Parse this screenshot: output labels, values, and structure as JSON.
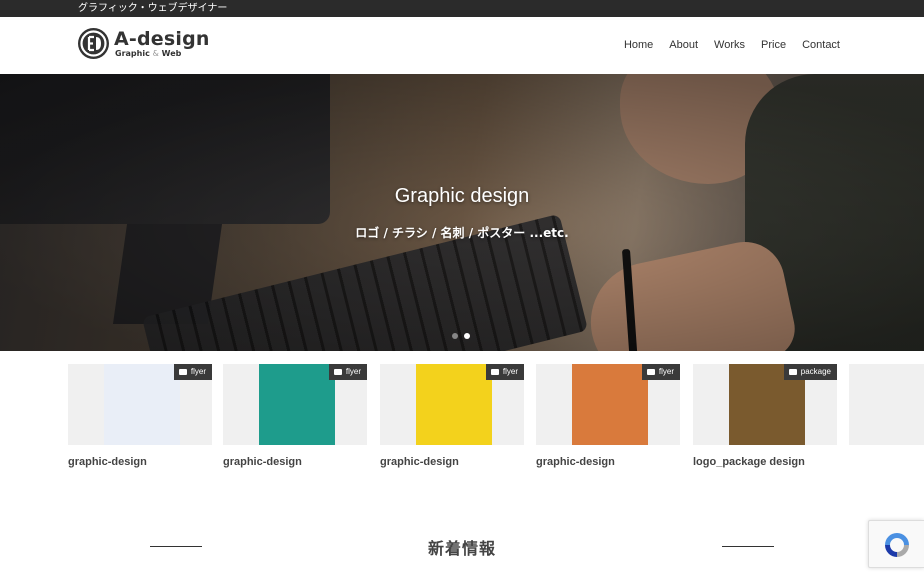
{
  "topbar": {
    "tagline": "グラフィック・ウェブデザイナー"
  },
  "logo": {
    "name": "A-design",
    "sub_a": "Graphic",
    "sub_amp": "&",
    "sub_b": "Web"
  },
  "nav": {
    "items": [
      "Home",
      "About",
      "Works",
      "Price",
      "Contact"
    ]
  },
  "hero": {
    "title": "Graphic design",
    "subtitle": "ロゴ / チラシ / 名刺 / ポスター ...etc.",
    "slide_count": 2,
    "active_slide": 2
  },
  "works": [
    {
      "label": "graphic-design",
      "badge": "flyer",
      "color": "#e9eef7"
    },
    {
      "label": "graphic-design",
      "badge": "flyer",
      "color": "#1e9c8c"
    },
    {
      "label": "graphic-design",
      "badge": "flyer",
      "color": "#f3d21c"
    },
    {
      "label": "graphic-design",
      "badge": "flyer",
      "color": "#d97a3c"
    },
    {
      "label": "logo_package design",
      "badge": "package",
      "color": "#7a5a2e"
    }
  ],
  "news": {
    "title": "新着情報"
  },
  "colors": {
    "topbar": "#2b2b2b",
    "badge": "#3a3a3a",
    "text": "#333333"
  }
}
